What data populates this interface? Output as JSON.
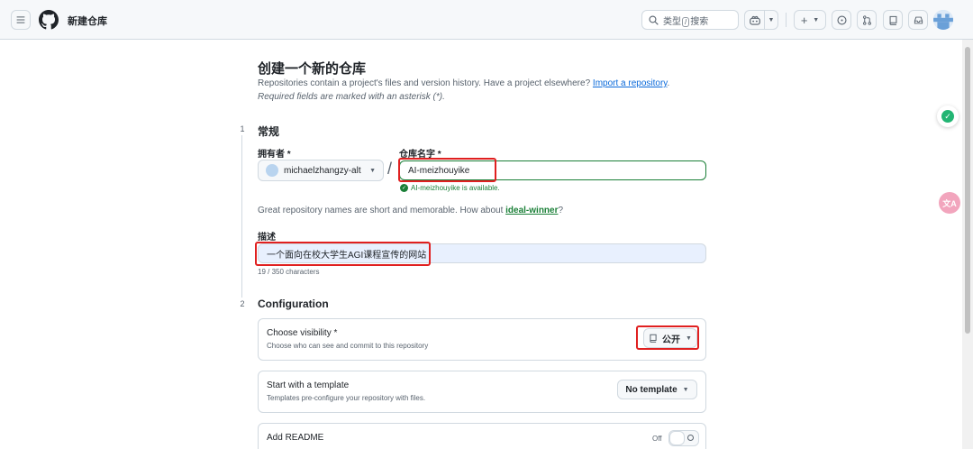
{
  "header": {
    "page_name": "新建仓库",
    "search_label_pre": "类型",
    "search_key": "/",
    "search_label_post": "搜索",
    "icons": [
      "hamburger-icon",
      "github-logo-icon",
      "search-icon",
      "copilot-icon",
      "plus-icon",
      "issues-icon",
      "pull-request-icon",
      "repo-icon",
      "inbox-icon"
    ]
  },
  "intro": {
    "title": "创建一个新的仓库",
    "description": "Repositories contain a project's files and version history. Have a project elsewhere?",
    "import_link": "Import a repository",
    "period": ".",
    "required_note": "Required fields are marked with an asterisk (*)."
  },
  "general": {
    "step": "1",
    "title": "常规",
    "owner_label": "拥有者 *",
    "owner_value": "michaelzhangzy-alt",
    "separator": "/",
    "name_label": "仓库名字 *",
    "name_value": "AI-meizhouyike",
    "available_msg": "AI-meizhouyike is available.",
    "suggest_pre": "Great repository names are short and memorable. How about",
    "suggest_name": "ideal-winner",
    "suggest_post": "?",
    "desc_label": "描述",
    "desc_value": "一个面向在校大学生AGI课程宣传的网站",
    "char_count": "19 / 350 characters"
  },
  "configuration": {
    "step": "2",
    "title": "Configuration",
    "visibility": {
      "title": "Choose visibility *",
      "subtitle": "Choose who can see and commit to this repository",
      "value": "公开"
    },
    "template": {
      "title": "Start with a template",
      "subtitle": "Templates pre-configure your repository with files.",
      "value": "No template"
    },
    "readme": {
      "title": "Add README",
      "toggle_state": "Off"
    }
  },
  "widgets": {
    "translate_label": "文A"
  },
  "colors": {
    "accent_link": "#0969da",
    "success": "#1a7f37",
    "highlight_box": "#e02020"
  }
}
